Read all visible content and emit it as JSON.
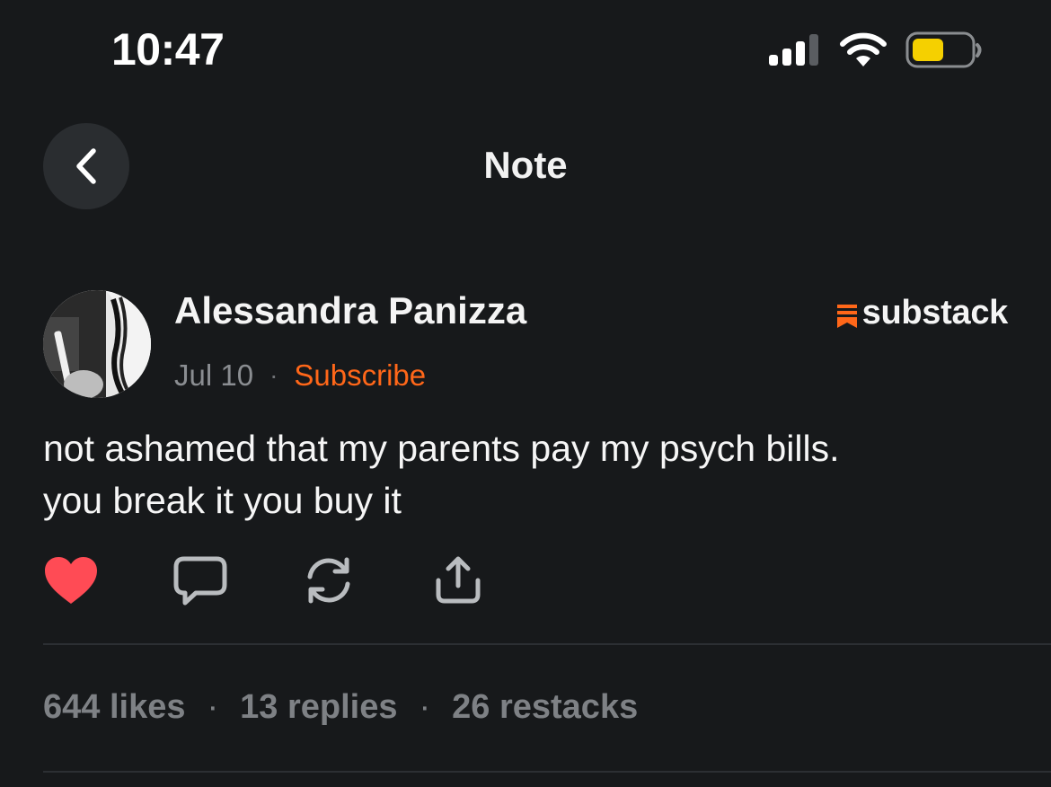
{
  "status_bar": {
    "time": "10:47",
    "battery_color": "#f5d000"
  },
  "nav": {
    "title": "Note",
    "back_icon": "chevron-left-icon"
  },
  "author": {
    "name": "Alessandra Panizza",
    "date": "Jul 10",
    "separator": "·",
    "subscribe_label": "Subscribe"
  },
  "brand": {
    "name": "substack",
    "color": "#ff6719"
  },
  "note": {
    "lines": [
      "not ashamed that my parents pay my psych bills.",
      "you break it you buy it"
    ]
  },
  "actions": [
    {
      "icon": "heart-icon",
      "active": true,
      "color": "#ff4b55"
    },
    {
      "icon": "comment-icon"
    },
    {
      "icon": "restack-icon"
    },
    {
      "icon": "share-icon"
    }
  ],
  "stats": {
    "likes": "644 likes",
    "replies": "13 replies",
    "restacks": "26 restacks",
    "separator": "·"
  }
}
